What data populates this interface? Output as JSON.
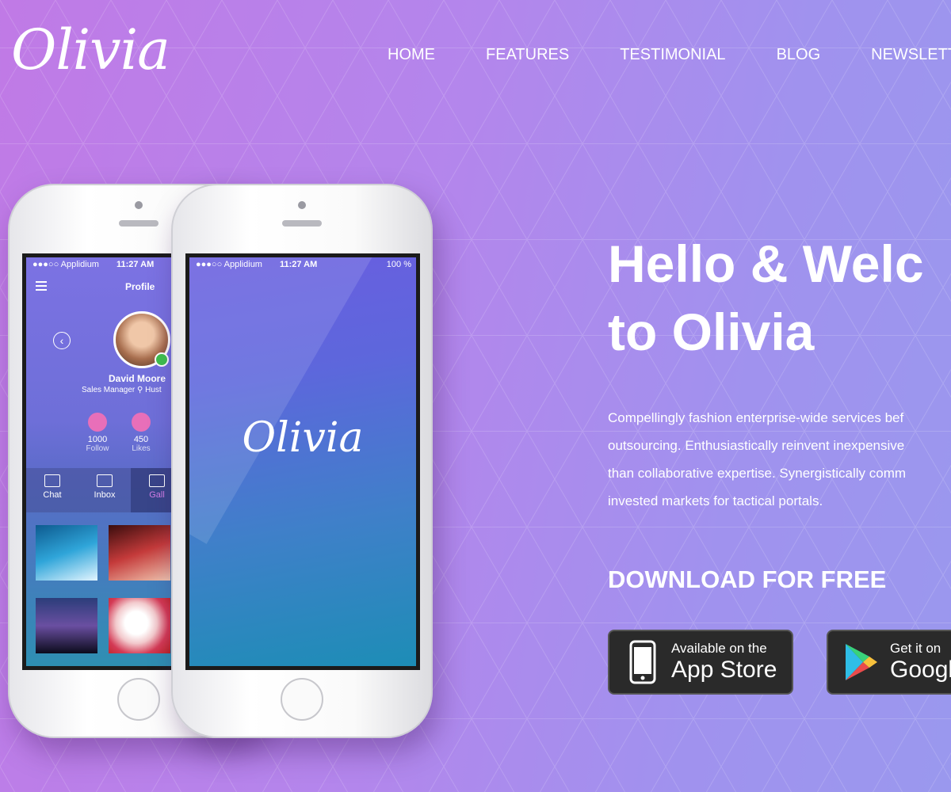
{
  "brand": {
    "logo_text": "Olivia"
  },
  "nav": {
    "items": [
      {
        "label": "HOME"
      },
      {
        "label": "FEATURES"
      },
      {
        "label": "TESTIMONIAL"
      },
      {
        "label": "BLOG"
      },
      {
        "label": "NEWSLETT"
      }
    ]
  },
  "hero": {
    "title_line1": "Hello & Welc",
    "title_line2": "to Olivia",
    "description_lines": [
      "Compellingly fashion enterprise-wide services bef",
      "outsourcing. Enthusiastically reinvent inexpensive",
      "than collaborative expertise. Synergistically comm",
      "invested markets for tactical portals."
    ],
    "download_heading": "DOWNLOAD FOR FREE"
  },
  "store_buttons": {
    "apple": {
      "small": "Available on the",
      "big": "App Store"
    },
    "google": {
      "small": "Get it on",
      "big": "Google"
    }
  },
  "phone_back": {
    "status": {
      "carrier": "●●●○○ Applidium",
      "time": "11:27 AM"
    },
    "header_title": "Profile",
    "user_name": "David Moore",
    "user_role": "Sales Manager  ⚲ Hust",
    "stats": [
      {
        "num": "1000",
        "label": "Follow"
      },
      {
        "num": "450",
        "label": "Likes"
      }
    ],
    "tabs": [
      {
        "label": "Chat"
      },
      {
        "label": "Inbox"
      },
      {
        "label": "Gall"
      }
    ]
  },
  "phone_front": {
    "status": {
      "carrier": "●●●○○ Applidium",
      "time": "11:27 AM",
      "battery": "100 %"
    },
    "splash_logo": "Olivia"
  },
  "colors": {
    "bg_left": "#c07ae6",
    "bg_right": "#9a98ee",
    "store_bg": "#2a2a2a"
  }
}
